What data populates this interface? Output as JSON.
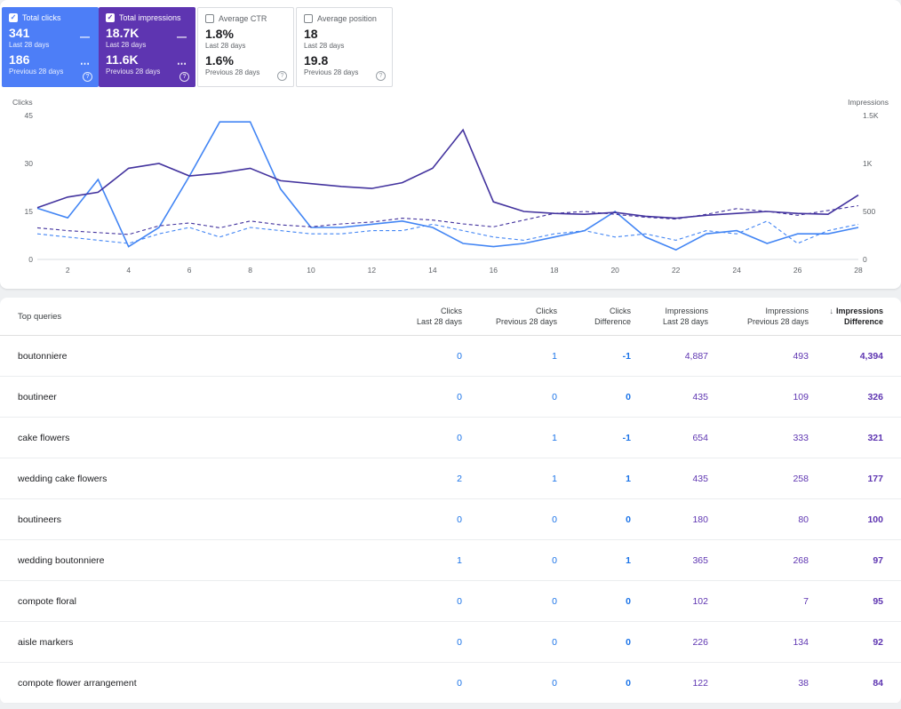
{
  "colors": {
    "clicks_card_bg": "#4d7ef7",
    "impressions_card_bg": "#5e35b1",
    "table_clicks_text": "#1a73e8",
    "table_impressions_text": "#5e35b1",
    "chart_clicks_line": "#4285f4",
    "chart_impressions_line": "#43339e"
  },
  "icons": {
    "checkmark": "✓",
    "help": "?",
    "sort_desc": "↓"
  },
  "cards": [
    {
      "label": "Total clicks",
      "checked": true,
      "value1": "341",
      "period1": "Last 28 days",
      "change1": "—",
      "value2": "186",
      "change2": "⋯",
      "period2": "Previous 28 days"
    },
    {
      "label": "Total impressions",
      "checked": true,
      "value1": "18.7K",
      "period1": "Last 28 days",
      "change1": "—",
      "value2": "11.6K",
      "change2": "⋯",
      "period2": "Previous 28 days"
    },
    {
      "label": "Average CTR",
      "checked": false,
      "value1": "1.8%",
      "period1": "Last 28 days",
      "value2": "1.6%",
      "period2": "Previous 28 days"
    },
    {
      "label": "Average position",
      "checked": false,
      "value1": "18",
      "period1": "Last 28 days",
      "value2": "19.8",
      "period2": "Previous 28 days"
    }
  ],
  "chart_data": {
    "type": "line",
    "x": [
      1,
      2,
      3,
      4,
      5,
      6,
      7,
      8,
      9,
      10,
      11,
      12,
      13,
      14,
      15,
      16,
      17,
      18,
      19,
      20,
      21,
      22,
      23,
      24,
      25,
      26,
      27,
      28
    ],
    "x_ticks": [
      2,
      4,
      6,
      8,
      10,
      12,
      14,
      16,
      18,
      20,
      22,
      24,
      26,
      28
    ],
    "left_axis": {
      "label": "Clicks",
      "max": 45,
      "ticks": [
        0,
        15,
        30,
        45
      ]
    },
    "right_axis": {
      "label": "Impressions",
      "max": 1500,
      "ticks": [
        {
          "label": "0",
          "value": 0
        },
        {
          "label": "500",
          "value": 500
        },
        {
          "label": "1K",
          "value": 1000
        },
        {
          "label": "1.5K",
          "value": 1500
        }
      ]
    },
    "series": [
      {
        "name": "Clicks (last 28 days)",
        "axis": "left",
        "style": "solid",
        "color": "#4285f4",
        "values": [
          16,
          13,
          25,
          4,
          10,
          26,
          43,
          43,
          22,
          10,
          10,
          11,
          12,
          10,
          5,
          4,
          5,
          7,
          9,
          15,
          7,
          3,
          8,
          9,
          5,
          8,
          8,
          10
        ]
      },
      {
        "name": "Clicks (previous 28 days)",
        "axis": "left",
        "style": "dashed",
        "color": "#4285f4",
        "values": [
          8,
          7,
          6,
          5,
          8,
          10,
          7,
          10,
          9,
          8,
          8,
          9,
          9,
          11,
          9,
          7,
          6,
          8,
          9,
          7,
          8,
          6,
          9,
          8,
          12,
          5,
          9,
          11
        ]
      },
      {
        "name": "Impressions (last 28 days)",
        "axis": "right",
        "style": "solid",
        "color": "#43339e",
        "values": [
          540,
          650,
          700,
          950,
          1000,
          870,
          900,
          950,
          820,
          790,
          760,
          740,
          800,
          950,
          1350,
          600,
          500,
          480,
          470,
          490,
          450,
          430,
          460,
          480,
          500,
          480,
          470,
          670
        ]
      },
      {
        "name": "Impressions (previous 28 days)",
        "axis": "right",
        "style": "dashed",
        "color": "#43339e",
        "values": [
          330,
          300,
          280,
          260,
          350,
          380,
          330,
          400,
          360,
          340,
          370,
          390,
          430,
          410,
          370,
          340,
          410,
          480,
          500,
          470,
          440,
          420,
          470,
          530,
          500,
          460,
          510,
          560
        ]
      }
    ]
  },
  "table": {
    "query_header": "Top queries",
    "columns": [
      {
        "line1": "Clicks",
        "line2": "Last 28 days"
      },
      {
        "line1": "Clicks",
        "line2": "Previous 28 days"
      },
      {
        "line1": "Clicks",
        "line2": "Difference"
      },
      {
        "line1": "Impressions",
        "line2": "Last 28 days"
      },
      {
        "line1": "Impressions",
        "line2": "Previous 28 days"
      },
      {
        "line1": "Impressions",
        "line2": "Difference",
        "sorted": true
      }
    ],
    "rows": [
      {
        "query": "boutonniere",
        "clicks_last": "0",
        "clicks_prev": "1",
        "clicks_diff": "-1",
        "impressions_last": "4,887",
        "impressions_prev": "493",
        "impressions_diff": "4,394"
      },
      {
        "query": "boutineer",
        "clicks_last": "0",
        "clicks_prev": "0",
        "clicks_diff": "0",
        "impressions_last": "435",
        "impressions_prev": "109",
        "impressions_diff": "326"
      },
      {
        "query": "cake flowers",
        "clicks_last": "0",
        "clicks_prev": "1",
        "clicks_diff": "-1",
        "impressions_last": "654",
        "impressions_prev": "333",
        "impressions_diff": "321"
      },
      {
        "query": "wedding cake flowers",
        "clicks_last": "2",
        "clicks_prev": "1",
        "clicks_diff": "1",
        "impressions_last": "435",
        "impressions_prev": "258",
        "impressions_diff": "177"
      },
      {
        "query": "boutineers",
        "clicks_last": "0",
        "clicks_prev": "0",
        "clicks_diff": "0",
        "impressions_last": "180",
        "impressions_prev": "80",
        "impressions_diff": "100"
      },
      {
        "query": "wedding boutonniere",
        "clicks_last": "1",
        "clicks_prev": "0",
        "clicks_diff": "1",
        "impressions_last": "365",
        "impressions_prev": "268",
        "impressions_diff": "97"
      },
      {
        "query": "compote floral",
        "clicks_last": "0",
        "clicks_prev": "0",
        "clicks_diff": "0",
        "impressions_last": "102",
        "impressions_prev": "7",
        "impressions_diff": "95"
      },
      {
        "query": "aisle markers",
        "clicks_last": "0",
        "clicks_prev": "0",
        "clicks_diff": "0",
        "impressions_last": "226",
        "impressions_prev": "134",
        "impressions_diff": "92"
      },
      {
        "query": "compote flower arrangement",
        "clicks_last": "0",
        "clicks_prev": "0",
        "clicks_diff": "0",
        "impressions_last": "122",
        "impressions_prev": "38",
        "impressions_diff": "84"
      }
    ]
  }
}
